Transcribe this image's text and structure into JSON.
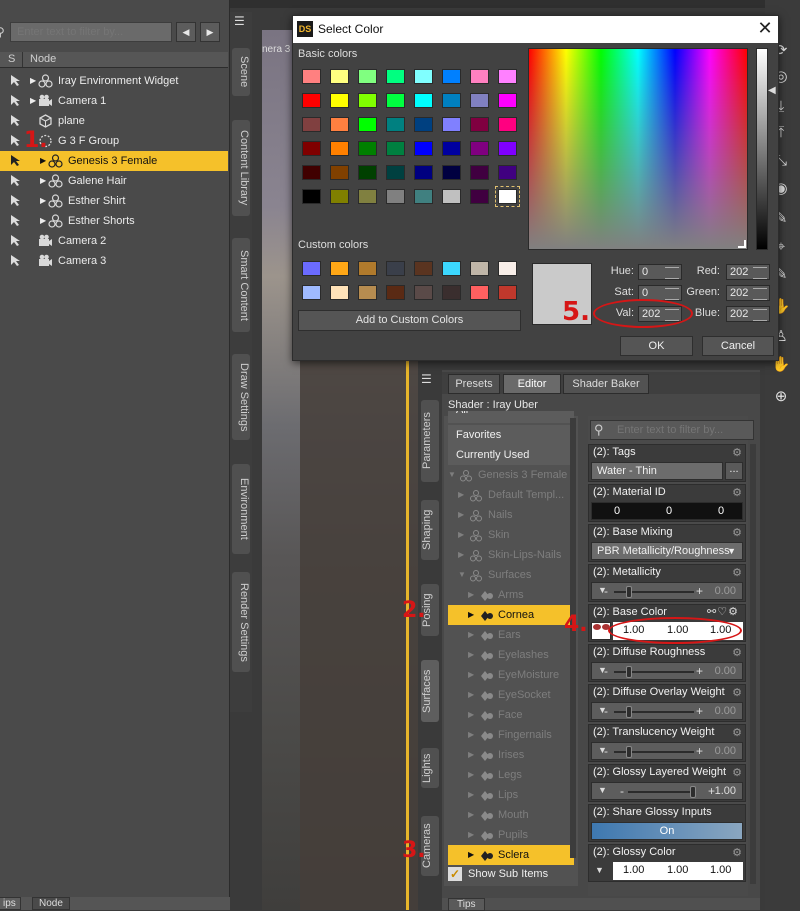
{
  "scene": {
    "filter_placeholder": "Enter text to filter by...",
    "col_s": "S",
    "col_node": "Node",
    "nodes": [
      {
        "label": "Iray Environment Widget",
        "icon": "figure-icon"
      },
      {
        "label": "Camera 1",
        "icon": "camera-icon"
      },
      {
        "label": "plane",
        "icon": "prop-icon"
      },
      {
        "label": "G 3 F Group",
        "icon": "group-icon"
      },
      {
        "label": "Genesis 3 Female",
        "icon": "figure-icon"
      },
      {
        "label": "Galene Hair",
        "icon": "figure-icon"
      },
      {
        "label": "Esther Shirt",
        "icon": "figure-icon"
      },
      {
        "label": "Esther Shorts",
        "icon": "figure-icon"
      },
      {
        "label": "Camera 2",
        "icon": "camera-icon"
      },
      {
        "label": "Camera 3",
        "icon": "camera-icon"
      }
    ],
    "bottom_tabs": [
      "ips",
      "Node"
    ]
  },
  "side_tabs": [
    "Scene",
    "Content Library",
    "Smart Content",
    "Draw Settings",
    "Environment",
    "Render Settings"
  ],
  "viewport_label": "nera 3",
  "surfaces_tabs": [
    "Parameters",
    "Shaping",
    "Posing",
    "Surfaces",
    "Lights",
    "Cameras"
  ],
  "editor": {
    "tabs": [
      "Presets",
      "Editor",
      "Shader Baker"
    ],
    "shader_label": "Shader : Iray Uber",
    "list_top": [
      {
        "label": "All",
        "bright": true
      },
      {
        "label": "Favorites",
        "bright": true
      },
      {
        "label": "Currently Used",
        "bright": true
      },
      {
        "label": "Genesis 3 Female",
        "bright": false
      },
      {
        "label": "Default Templ...",
        "bright": false
      },
      {
        "label": "Nails",
        "bright": false
      },
      {
        "label": "Skin",
        "bright": false
      },
      {
        "label": "Skin-Lips-Nails",
        "bright": false
      },
      {
        "label": "Surfaces",
        "bright": false
      },
      {
        "label": "Arms",
        "bright": false
      },
      {
        "label": "Cornea",
        "bright": false
      },
      {
        "label": "Ears",
        "bright": false
      },
      {
        "label": "Eyelashes",
        "bright": false
      },
      {
        "label": "EyeMoisture",
        "bright": false
      },
      {
        "label": "EyeSocket",
        "bright": false
      },
      {
        "label": "Face",
        "bright": false
      },
      {
        "label": "Fingernails",
        "bright": false
      },
      {
        "label": "Irises",
        "bright": false
      },
      {
        "label": "Legs",
        "bright": false
      },
      {
        "label": "Lips",
        "bright": false
      },
      {
        "label": "Mouth",
        "bright": false
      },
      {
        "label": "Pupils",
        "bright": false
      },
      {
        "label": "Sclera",
        "bright": false
      }
    ],
    "show_sub_items": "Show Sub Items",
    "tips": "Tips",
    "prop_filter_placeholder": "Enter text to filter by...",
    "props": {
      "tags_title": "(2): Tags",
      "tags_value": "Water - Thin",
      "tags_more": "...",
      "matid_title": "(2): Material ID",
      "matid_values": [
        "0",
        "0",
        "0"
      ],
      "basemix_title": "(2): Base Mixing",
      "basemix_value": "PBR Metallicity/Roughness",
      "metal_title": "(2): Metallicity",
      "metal_value": "0.00",
      "basecolor_title": "(2): Base Color",
      "basecolor_values": [
        "1.00",
        "1.00",
        "1.00"
      ],
      "diffrough_title": "(2): Diffuse Roughness",
      "diffrough_value": "0.00",
      "diffoverlay_title": "(2): Diffuse Overlay Weight",
      "diffoverlay_value": "0.00",
      "transl_title": "(2): Translucency Weight",
      "transl_value": "0.00",
      "glossylayer_title": "(2): Glossy Layered Weight",
      "glossylayer_value": "1.00",
      "sharegloss_title": "(2): Share Glossy Inputs",
      "sharegloss_value": "On",
      "glosscolor_title": "(2): Glossy Color",
      "glosscolor_values": [
        "1.00",
        "1.00",
        "1.00"
      ]
    }
  },
  "dialog": {
    "logo": "DS",
    "title": "Select Color",
    "close": "✕",
    "basic_label": "Basic colors",
    "custom_label": "Custom colors",
    "add_custom": "Add to Custom Colors",
    "basic_colors": [
      [
        "#ff8080",
        "#ffff80",
        "#80ff80",
        "#00ff80",
        "#80ffff",
        "#0080ff",
        "#ff80c0",
        "#ff80ff"
      ],
      [
        "#ff0000",
        "#ffff00",
        "#80ff00",
        "#00ff40",
        "#00ffff",
        "#0080c0",
        "#8080c0",
        "#ff00ff"
      ],
      [
        "#804040",
        "#ff8040",
        "#00ff00",
        "#008080",
        "#004080",
        "#8080ff",
        "#800040",
        "#ff0080"
      ],
      [
        "#800000",
        "#ff8000",
        "#008000",
        "#008040",
        "#0000ff",
        "#0000a0",
        "#800080",
        "#8000ff"
      ],
      [
        "#400000",
        "#804000",
        "#004000",
        "#004040",
        "#000080",
        "#000040",
        "#400040",
        "#400080"
      ],
      [
        "#000000",
        "#808000",
        "#808040",
        "#808080",
        "#408080",
        "#c0c0c0",
        "#400040",
        "#ffffff"
      ]
    ],
    "custom_colors": [
      [
        "#6b6bff",
        "#ffa716",
        "#b07a2c",
        "#3a3f4a",
        "#5a3420",
        "#3cd8ff",
        "#c0b6a8",
        "#f8eee8"
      ],
      [
        "#9fbaff",
        "#ffe2b8",
        "#b68c50",
        "#5a2a14",
        "#5a4a48",
        "#3a2e2e",
        "#ff6060",
        "#c0382c"
      ]
    ],
    "fields": {
      "hue_label": "Hue:",
      "hue": "0",
      "sat_label": "Sat:",
      "sat": "0",
      "val_label": "Val:",
      "val": "202",
      "red_label": "Red:",
      "red": "202",
      "green_label": "Green:",
      "green": "202",
      "blue_label": "Blue:",
      "blue": "202"
    },
    "ok": "OK",
    "cancel": "Cancel"
  },
  "annotations": [
    "1.",
    "2.",
    "3.",
    "4.",
    "5."
  ],
  "colors": {
    "accent": "#f5c12a",
    "annotation": "#d61616"
  }
}
